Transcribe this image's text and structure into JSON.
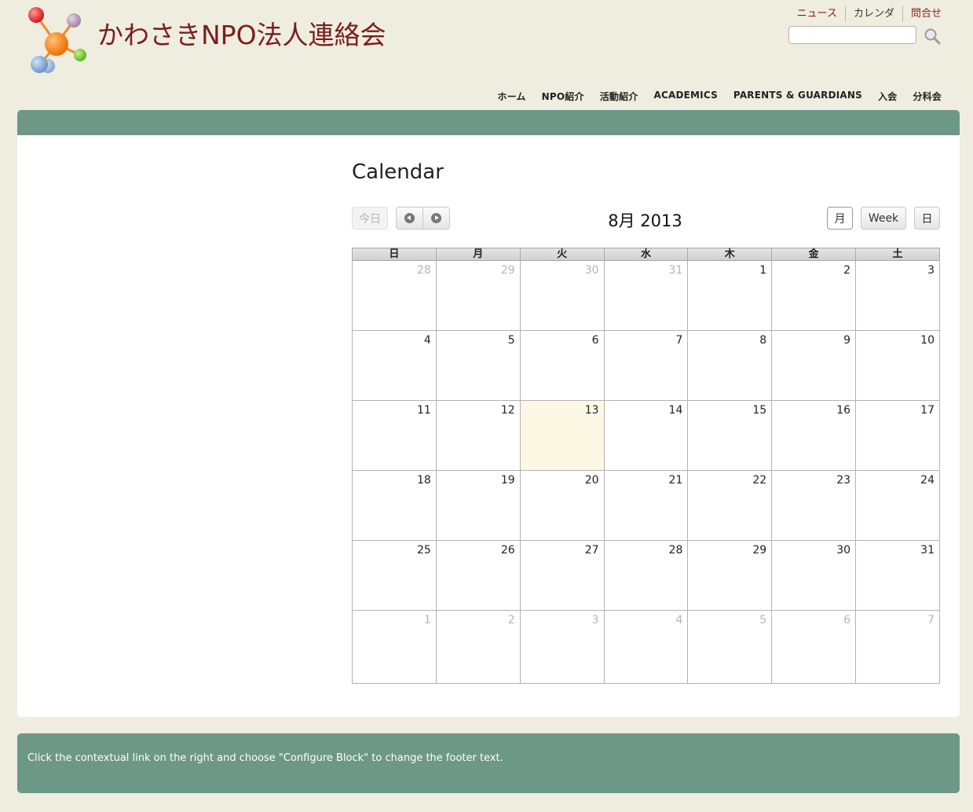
{
  "site": {
    "title": "かわさきNPO法人連絡会"
  },
  "toplinks": [
    {
      "label": "ニュース"
    },
    {
      "label": "カレンダ"
    },
    {
      "label": "問合せ"
    }
  ],
  "search": {
    "placeholder": "",
    "value": ""
  },
  "nav": [
    {
      "label": "ホーム"
    },
    {
      "label": "NPO紹介"
    },
    {
      "label": "活動紹介"
    },
    {
      "label": "ACADEMICS"
    },
    {
      "label": "PARENTS & GUARDIANS"
    },
    {
      "label": "入会"
    },
    {
      "label": "分科会"
    }
  ],
  "page": {
    "title": "Calendar"
  },
  "calendar": {
    "today_label": "今日",
    "month_title": "8月 2013",
    "views": {
      "month": "月",
      "week": "Week",
      "day": "日"
    },
    "weekdays": [
      "日",
      "月",
      "火",
      "水",
      "木",
      "金",
      "土"
    ],
    "weeks": [
      [
        {
          "d": "28",
          "o": true
        },
        {
          "d": "29",
          "o": true
        },
        {
          "d": "30",
          "o": true
        },
        {
          "d": "31",
          "o": true
        },
        {
          "d": "1"
        },
        {
          "d": "2"
        },
        {
          "d": "3"
        }
      ],
      [
        {
          "d": "4"
        },
        {
          "d": "5"
        },
        {
          "d": "6"
        },
        {
          "d": "7"
        },
        {
          "d": "8"
        },
        {
          "d": "9"
        },
        {
          "d": "10"
        }
      ],
      [
        {
          "d": "11"
        },
        {
          "d": "12"
        },
        {
          "d": "13",
          "today": true
        },
        {
          "d": "14"
        },
        {
          "d": "15"
        },
        {
          "d": "16"
        },
        {
          "d": "17"
        }
      ],
      [
        {
          "d": "18"
        },
        {
          "d": "19"
        },
        {
          "d": "20"
        },
        {
          "d": "21"
        },
        {
          "d": "22"
        },
        {
          "d": "23"
        },
        {
          "d": "24"
        }
      ],
      [
        {
          "d": "25"
        },
        {
          "d": "26"
        },
        {
          "d": "27"
        },
        {
          "d": "28"
        },
        {
          "d": "29"
        },
        {
          "d": "30"
        },
        {
          "d": "31"
        }
      ],
      [
        {
          "d": "1",
          "o": true
        },
        {
          "d": "2",
          "o": true
        },
        {
          "d": "3",
          "o": true
        },
        {
          "d": "4",
          "o": true
        },
        {
          "d": "5",
          "o": true
        },
        {
          "d": "6",
          "o": true
        },
        {
          "d": "7",
          "o": true
        }
      ]
    ]
  },
  "footer": {
    "text": "Click the contextual link on the right and choose \"Configure Block\" to change the footer text."
  },
  "colors": {
    "accent_green": "#6d9786",
    "title_red": "#7a1e1a",
    "today_bg": "#fcf8e3"
  }
}
